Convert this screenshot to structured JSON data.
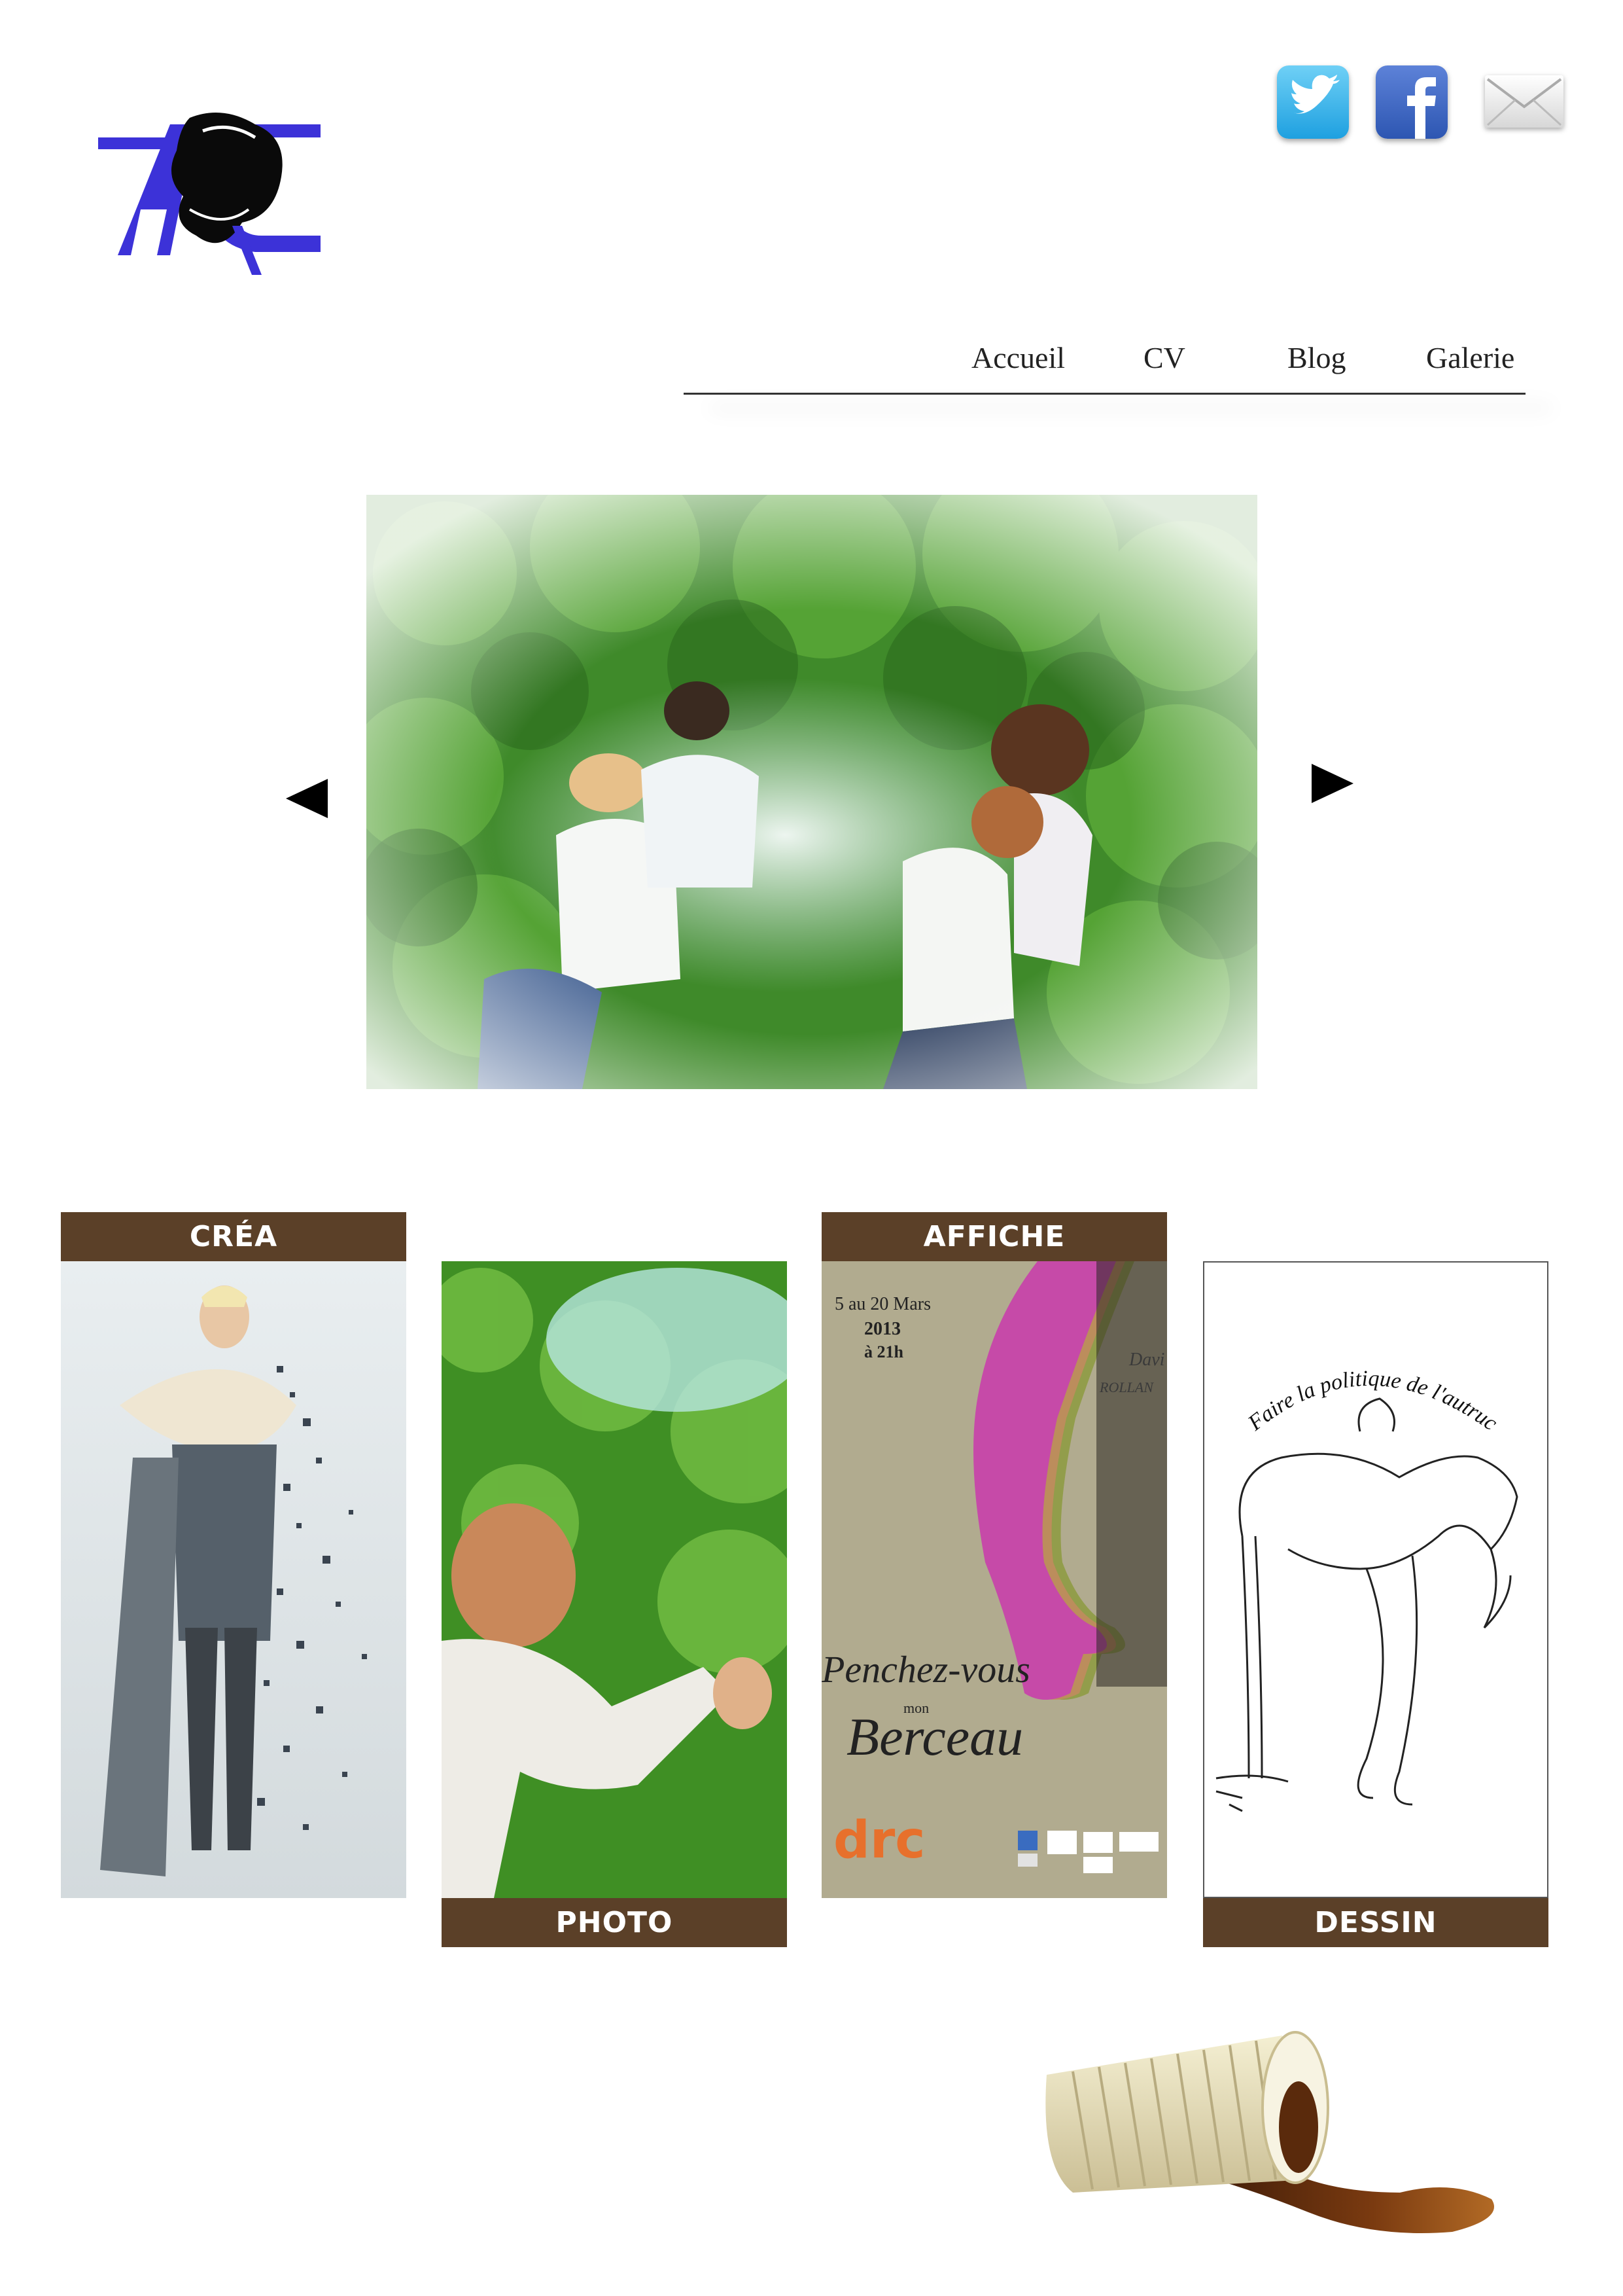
{
  "logo": {
    "letters": "AC"
  },
  "social": {
    "twitter_icon": "twitter-icon",
    "facebook_icon": "facebook-icon",
    "mail_icon": "mail-icon"
  },
  "nav": {
    "items": [
      {
        "label": "Accueil"
      },
      {
        "label": "CV"
      },
      {
        "label": "Blog"
      },
      {
        "label": "Galerie"
      }
    ]
  },
  "slider": {
    "prev_icon": "triangle-left-icon",
    "next_icon": "triangle-right-icon"
  },
  "cards": [
    {
      "label": "CRÉA"
    },
    {
      "label": "PHOTO"
    },
    {
      "label": "AFFICHE"
    },
    {
      "label": "DESSIN"
    }
  ],
  "affiche": {
    "date_line1": "5 au 20 Mars",
    "date_line2": "2013",
    "date_line3": "à 21h",
    "title_line1": "Penchez-vous",
    "title_small": "mon",
    "title_line2": "Berceau",
    "author1": "Davi",
    "author2": "ROLLAN",
    "brand": "drc"
  },
  "dessin": {
    "caption": "Faire la politique de l'autruche"
  },
  "colors": {
    "accent": "#5b4028",
    "logo_blue": "#3c32d8"
  }
}
